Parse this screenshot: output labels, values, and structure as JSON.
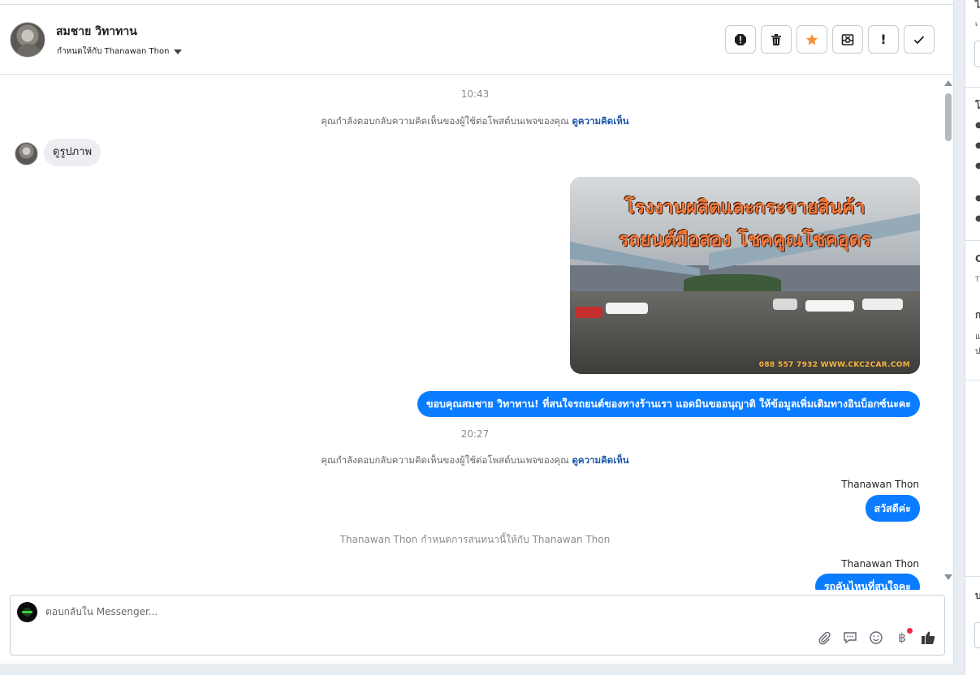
{
  "header": {
    "contact_name": "สมชาย วิทาทาน",
    "assigned_to": "กำหนดให้กับ Thanawan Thon",
    "actions": [
      {
        "name": "report-icon",
        "label": "!"
      },
      {
        "name": "trash-icon",
        "label": ""
      },
      {
        "name": "star-icon",
        "label": ""
      },
      {
        "name": "archive-icon",
        "label": ""
      },
      {
        "name": "exclamation-icon",
        "label": "!"
      },
      {
        "name": "check-icon",
        "label": ""
      }
    ],
    "star_color": "#f7923b"
  },
  "conversation": {
    "time_1": "10:43",
    "system_1": "คุณกำลังตอบกลับความคิดเห็นของผู้ใช้ต่อโพสต์บนเพจของคุณ",
    "system_1_link": "ดูความคิดเห็น",
    "incoming_1": "ดูรูปภาพ",
    "image": {
      "title_line_1": "โรงงานผลิตและกระจายสินค้า",
      "title_line_2": "รถยนต์มือสอง โชคคูณโชคอุดร",
      "footer": "088 557 7932 WWW.CKC2CAR.COM"
    },
    "outgoing_1": "ขอบคุณสมชาย วิทาทาน! ที่สนใจรถยนต์ของทางร้านเรา แอดมินขออนุญาติ ให้ข้อมูลเพิ่มเติมทางอินบ็อกซ์นะคะ",
    "time_2": "20:27",
    "system_2": "คุณกำลังตอบกลับความคิดเห็นของผู้ใช้ต่อโพสต์บนเพจของคุณ",
    "system_2_link": "ดูความคิดเห็น",
    "sender_1": "Thanawan Thon",
    "outgoing_2": "สวัสดีค่ะ",
    "system_3": "Thanawan Thon กำหนดการสนทนานี้ให้กับ Thanawan Thon",
    "sender_2": "Thanawan Thon",
    "outgoing_3": "รถคันไหนที่สนใจคะ"
  },
  "composer": {
    "placeholder": "ตอบกลับใน Messenger...",
    "tools": [
      "attachment-icon",
      "saved-reply-icon",
      "emoji-icon",
      "baht-icon",
      "like-icon"
    ],
    "baht_symbol": "฿"
  },
  "right_panel": {
    "glyphs": [
      "ไ",
      "เ",
      "โ",
      "C",
      "T",
      "ก",
      "แ",
      "ป",
      "บ"
    ]
  },
  "colors": {
    "accent": "#0a7cff",
    "link": "#1b55a8",
    "notify_dot": "#f02849"
  }
}
